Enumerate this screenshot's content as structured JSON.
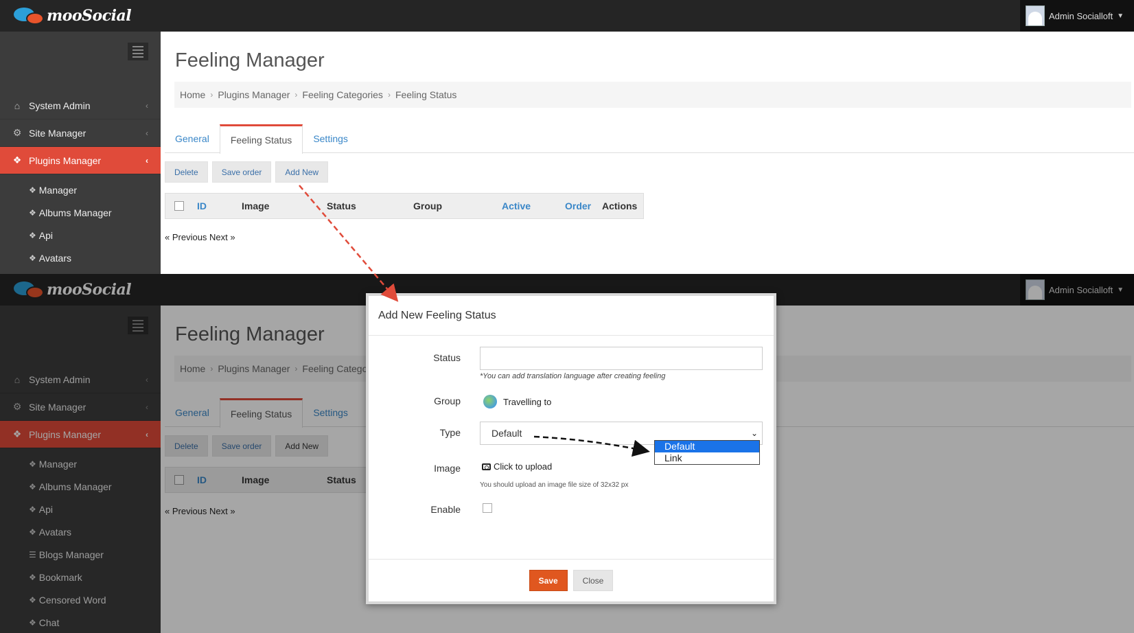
{
  "brand": {
    "name": "mooSocial"
  },
  "user": {
    "name": "Admin Socialloft"
  },
  "sidebar": {
    "items": [
      {
        "label": "System Admin",
        "icon": "home-icon"
      },
      {
        "label": "Site Manager",
        "icon": "gears-icon"
      },
      {
        "label": "Plugins Manager",
        "icon": "tag-icon"
      }
    ],
    "sub_items_top": [
      {
        "label": "Manager"
      },
      {
        "label": "Albums Manager"
      },
      {
        "label": "Api"
      },
      {
        "label": "Avatars"
      }
    ],
    "sub_items_bottom": [
      {
        "label": "Manager"
      },
      {
        "label": "Albums Manager"
      },
      {
        "label": "Api"
      },
      {
        "label": "Avatars"
      },
      {
        "label": "Blogs Manager"
      },
      {
        "label": "Bookmark"
      },
      {
        "label": "Censored Word"
      },
      {
        "label": "Chat"
      }
    ]
  },
  "page": {
    "title": "Feeling Manager",
    "breadcrumb": [
      "Home",
      "Plugins Manager",
      "Feeling Categories",
      "Feeling Status"
    ],
    "breadcrumb_bottom": [
      "Home",
      "Plugins Manager",
      "Feeling Catego"
    ],
    "tabs": [
      "General",
      "Feeling Status",
      "Settings"
    ],
    "toolbar": {
      "delete": "Delete",
      "save_order": "Save order",
      "add_new": "Add New"
    },
    "columns": {
      "id": "ID",
      "image": "Image",
      "status": "Status",
      "group": "Group",
      "active": "Active",
      "order": "Order",
      "actions": "Actions"
    },
    "pager": "« Previous Next »"
  },
  "modal": {
    "title": "Add New Feeling Status",
    "status_label": "Status",
    "status_value": "",
    "status_hint": "*You can add translation language after creating feeling",
    "group_label": "Group",
    "group_value": "Travelling to",
    "type_label": "Type",
    "type_value": "Default",
    "type_options": [
      "Default",
      "Link"
    ],
    "image_label": "Image",
    "upload_text": "Click to upload",
    "upload_hint": "You should upload an image file size of 32x32 px",
    "enable_label": "Enable",
    "enable_checked": false,
    "save_label": "Save",
    "close_label": "Close"
  },
  "colors": {
    "accent": "#e04b3a",
    "link": "#3a87c8",
    "save": "#e0571f",
    "topbar": "#252525",
    "sidebar": "#3c3c3c"
  }
}
